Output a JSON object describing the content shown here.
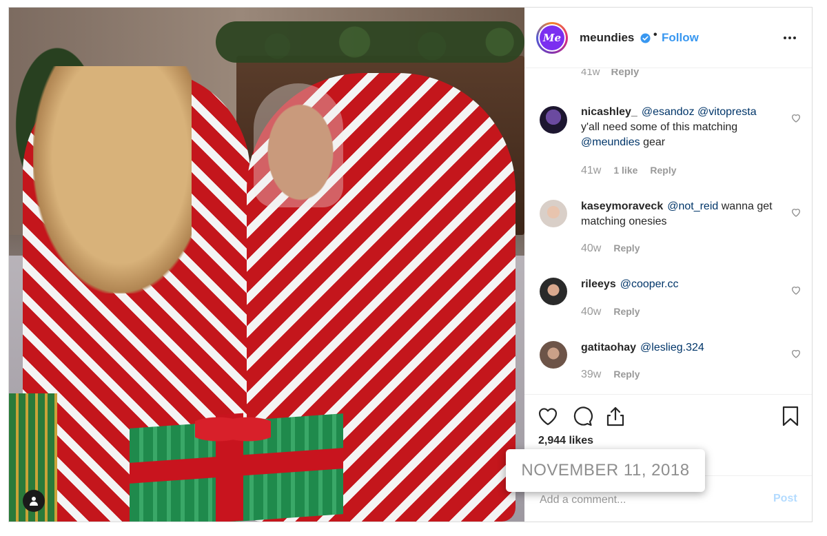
{
  "post": {
    "username": "meundies",
    "avatar_text": "Me",
    "follow_label": "Follow",
    "separator": "•",
    "likes": "2,944 likes",
    "comment_placeholder": "Add a comment...",
    "post_label": "Post",
    "date": "NOVEMBER 11, 2018"
  },
  "partial_comment": {
    "time": "41w",
    "reply": "Reply"
  },
  "comments": [
    {
      "user": "nicashley_",
      "mention1": "@esandoz",
      "mention2": "@vitopresta",
      "text1": "y'all need some of this matching",
      "mention3": "@meundies",
      "text2": "gear",
      "time": "41w",
      "likes": "1 like",
      "reply": "Reply"
    },
    {
      "user": "kaseymoraveck",
      "mention1": "@not_reid",
      "text1": "wanna get matching onesies",
      "time": "40w",
      "reply": "Reply"
    },
    {
      "user": "rileeys",
      "mention1": "@cooper.cc",
      "time": "40w",
      "reply": "Reply"
    },
    {
      "user": "gatitaohay",
      "mention1": "@leslieg.324",
      "time": "39w",
      "reply": "Reply"
    }
  ],
  "icons": {
    "like": "heart-icon",
    "comment": "comment-bubble-icon",
    "share": "share-icon",
    "save": "bookmark-icon",
    "more": "more-options-icon",
    "verified": "verified-badge-icon",
    "user_tag": "user-tag-icon"
  },
  "colors": {
    "accent": "#3897f0",
    "mention": "#003569",
    "muted": "#999999",
    "post_disabled": "#b3dbff"
  }
}
